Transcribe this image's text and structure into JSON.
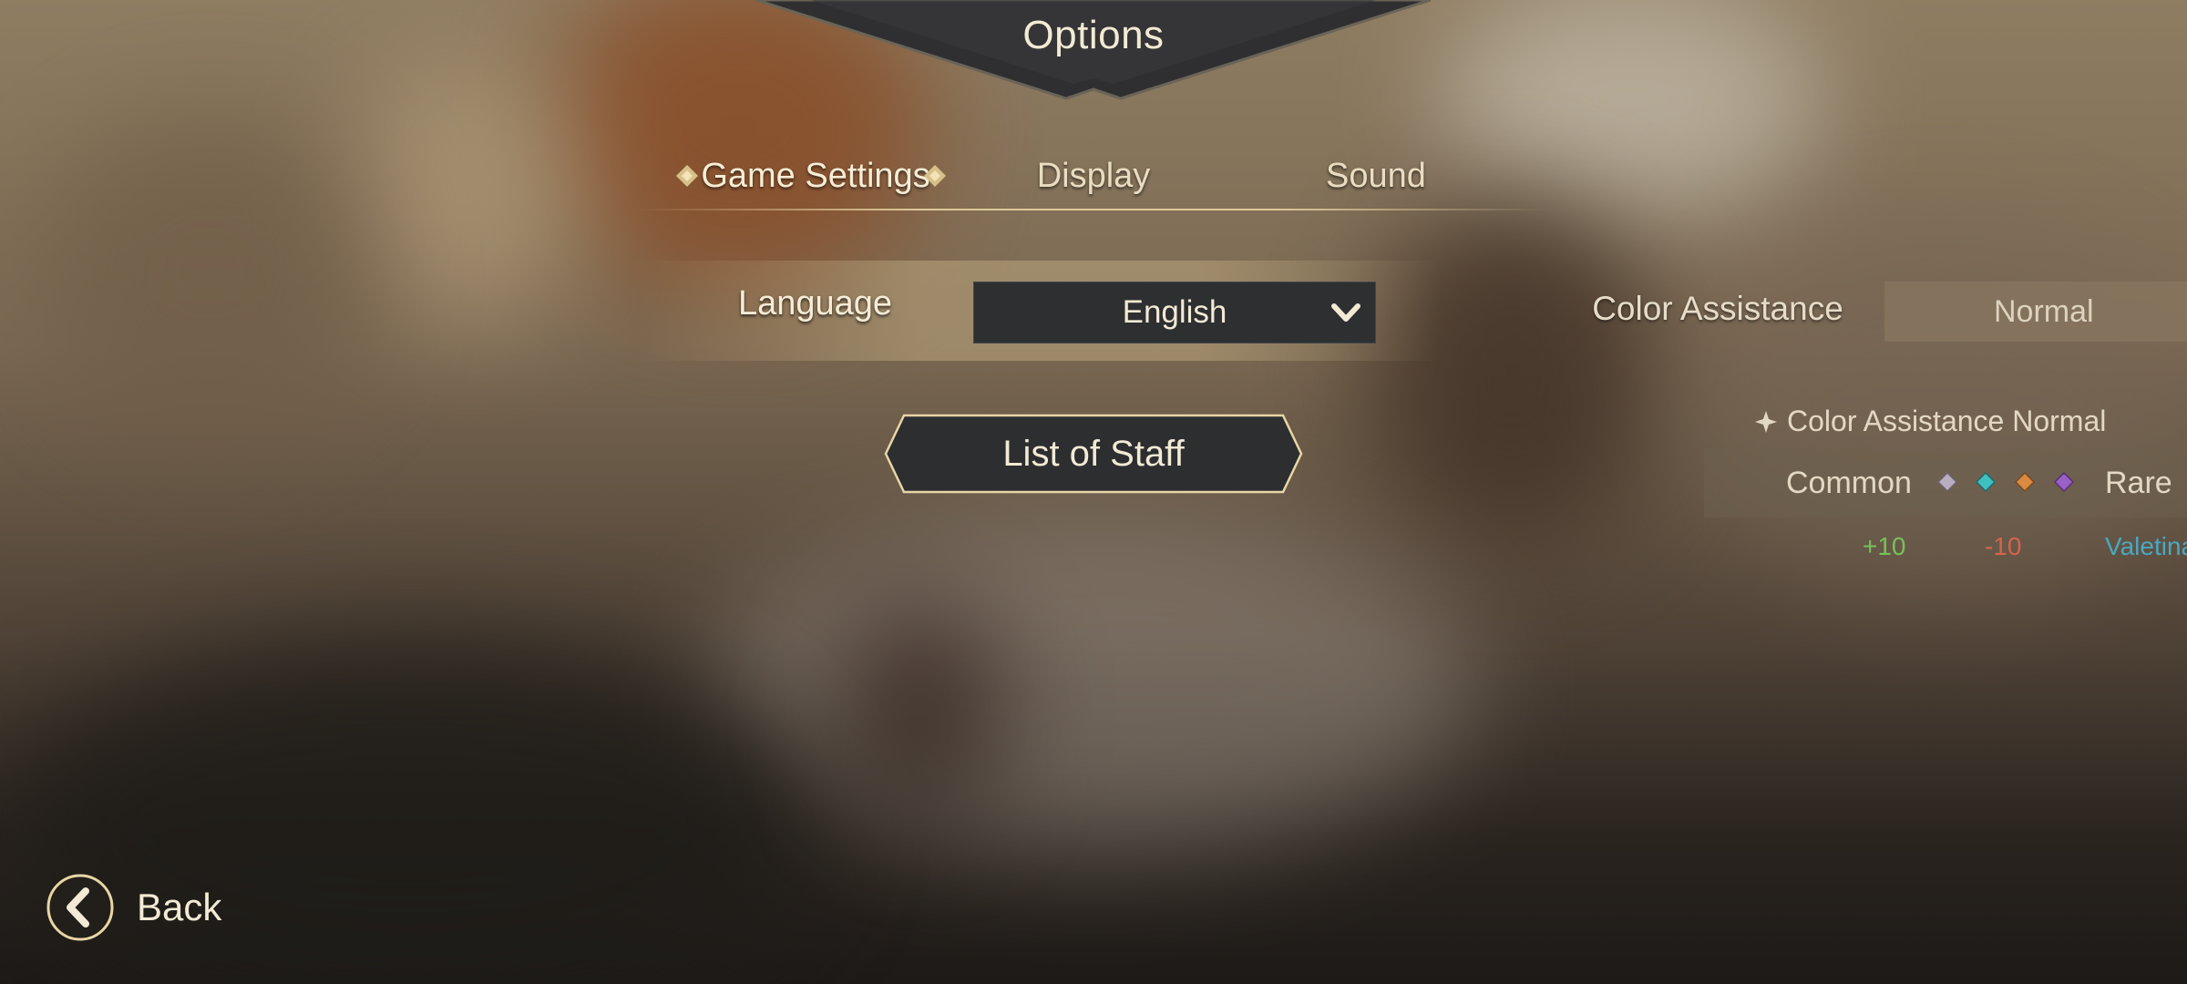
{
  "header": {
    "title": "Options"
  },
  "tabs": [
    {
      "label": "Game Settings",
      "selected": true
    },
    {
      "label": "Display",
      "selected": false
    },
    {
      "label": "Sound",
      "selected": false
    }
  ],
  "game_settings": {
    "language": {
      "label": "Language",
      "value": "English"
    },
    "staff_button": {
      "label": "List of Staff"
    }
  },
  "color_assistance": {
    "label": "Color Assistance",
    "value": "Normal",
    "preview_title": "Color Assistance Normal",
    "rarity_low": "Common",
    "rarity_high": "Rare",
    "gem_colors": [
      "#b8aec0",
      "#3ec0c0",
      "#d98a40",
      "#9a60c8"
    ],
    "samples": [
      "+10",
      "-10",
      "Valetina"
    ]
  },
  "footer": {
    "back_label": "Back"
  },
  "colors": {
    "text": "#f3ead5",
    "accent_gold": "#e6d2a0",
    "panel_dark": "#2d2f31"
  }
}
